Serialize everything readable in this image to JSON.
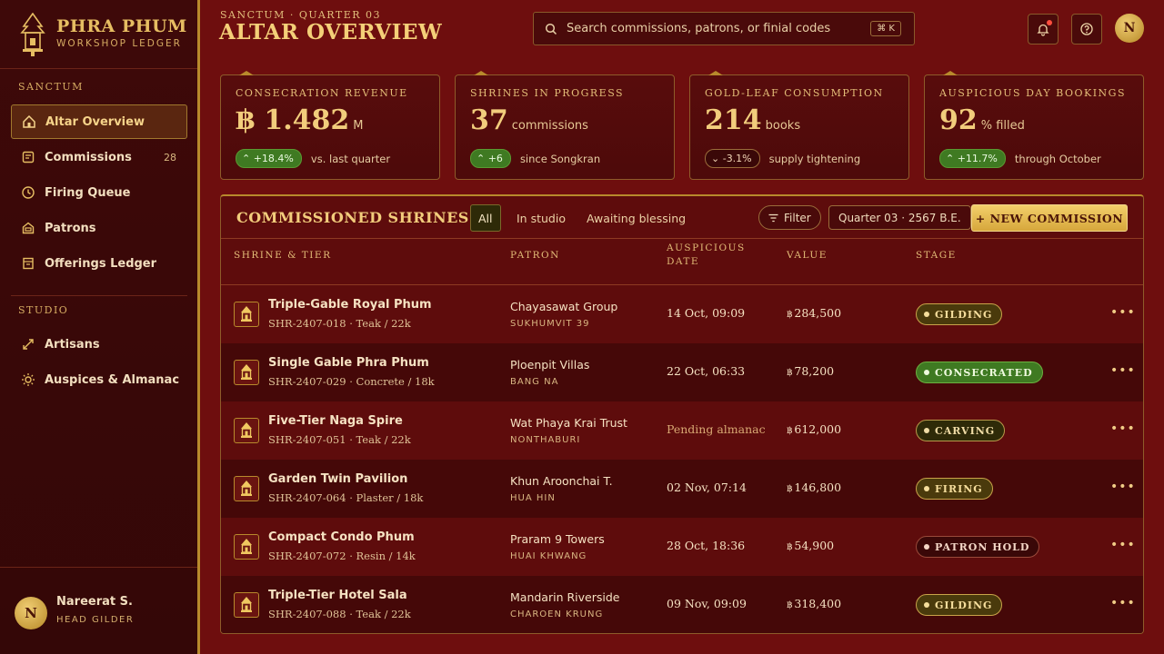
{
  "brand": {
    "title": "PHRA PHUM",
    "subtitle": "WORKSHOP LEDGER"
  },
  "sidebar": {
    "section1": "SANCTUM",
    "section2": "STUDIO",
    "items": [
      {
        "label": "Altar Overview",
        "icon": "shrine-icon"
      },
      {
        "label": "Commissions",
        "icon": "document-icon",
        "count": "28"
      },
      {
        "label": "Firing Queue",
        "icon": "clock-icon"
      },
      {
        "label": "Patrons",
        "icon": "building-icon"
      },
      {
        "label": "Offerings Ledger",
        "icon": "ledger-icon"
      }
    ],
    "studio_items": [
      {
        "label": "Artisans",
        "icon": "expand-arrows-icon"
      },
      {
        "label": "Auspices & Almanac",
        "icon": "sun-icon"
      }
    ],
    "user": {
      "initial": "N",
      "name": "Nareerat S.",
      "role": "HEAD GILDER"
    }
  },
  "header": {
    "breadcrumb": "SANCTUM  ·  QUARTER 03",
    "title": "ALTAR OVERVIEW",
    "search_placeholder": "Search commissions, patrons, or finial codes",
    "search_shortcut": "⌘ K",
    "avatar_initial": "N"
  },
  "stats": [
    {
      "label": "CONSECRATION REVENUE",
      "value": "฿ 1.482",
      "unit": "M",
      "delta": "+18.4%",
      "direction": "up",
      "note": "vs. last quarter"
    },
    {
      "label": "SHRINES IN PROGRESS",
      "value": "37",
      "unit": "commissions",
      "delta": "+6",
      "direction": "up",
      "note": "since Songkran"
    },
    {
      "label": "GOLD-LEAF CONSUMPTION",
      "value": "214",
      "unit": "books",
      "delta": "-3.1%",
      "direction": "down",
      "note": "supply tightening"
    },
    {
      "label": "AUSPICIOUS DAY BOOKINGS",
      "value": "92",
      "unit": "% filled",
      "delta": "+11.7%",
      "direction": "up",
      "note": "through October"
    }
  ],
  "table": {
    "title": "COMMISSIONED SHRINES",
    "tabs": [
      "All",
      "In studio",
      "Awaiting blessing"
    ],
    "filter_label": "Filter",
    "period_label": "Quarter 03 · 2567 B.E.",
    "new_button": "+ NEW COMMISSION",
    "columns": {
      "shrine": "SHRINE & TIER",
      "patron": "PATRON",
      "date_line1": "AUSPICIOUS",
      "date_line2": "DATE",
      "value": "VALUE",
      "stage": "STAGE"
    },
    "rows": [
      {
        "name": "Triple-Gable Royal Phum",
        "code": "SHR-2407-018 · Teak / 22k",
        "patron": "Chayasawat Group",
        "location": "SUKHUMVIT 39",
        "date": "14 Oct, 09:09",
        "value": "284,500",
        "stage": "GILDING",
        "stage_type": "gilding"
      },
      {
        "name": "Single Gable Phra Phum",
        "code": "SHR-2407-029 · Concrete / 18k",
        "patron": "Ploenpit Villas",
        "location": "BANG NA",
        "date": "22 Oct, 06:33",
        "value": "78,200",
        "stage": "CONSECRATED",
        "stage_type": "consecrated"
      },
      {
        "name": "Five-Tier Naga Spire",
        "code": "SHR-2407-051 · Teak / 22k",
        "patron": "Wat Phaya Krai Trust",
        "location": "NONTHABURI",
        "date": "Pending almanac",
        "value": "612,000",
        "stage": "CARVING",
        "stage_type": "carving"
      },
      {
        "name": "Garden Twin Pavilion",
        "code": "SHR-2407-064 · Plaster / 18k",
        "patron": "Khun Aroonchai T.",
        "location": "HUA HIN",
        "date": "02 Nov, 07:14",
        "value": "146,800",
        "stage": "FIRING",
        "stage_type": "firing"
      },
      {
        "name": "Compact Condo Phum",
        "code": "SHR-2407-072 · Resin / 14k",
        "patron": "Praram 9 Towers",
        "location": "HUAI KHWANG",
        "date": "28 Oct, 18:36",
        "value": "54,900",
        "stage": "PATRON HOLD",
        "stage_type": "hold"
      },
      {
        "name": "Triple-Tier Hotel Sala",
        "code": "SHR-2407-088 · Teak / 22k",
        "patron": "Mandarin Riverside",
        "location": "CHAROEN KRUNG",
        "date": "09 Nov, 09:09",
        "value": "318,400",
        "stage": "GILDING",
        "stage_type": "gilding"
      }
    ]
  },
  "colors": {
    "accent_gold": "#f2cd7c",
    "background": "#6e0e0e",
    "success": "#3f7a22"
  }
}
